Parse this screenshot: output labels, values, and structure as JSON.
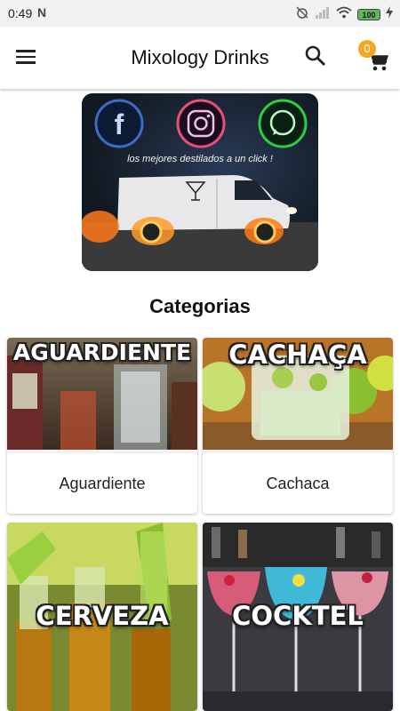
{
  "status_bar": {
    "time": "0:49",
    "notification_letter": "N",
    "battery_level": "100"
  },
  "app_bar": {
    "title": "Mixology Drinks",
    "cart_count": "0",
    "icons": [
      "menu-icon",
      "search-icon",
      "cart-icon"
    ]
  },
  "banner": {
    "tagline": "los mejores destilados a un click !",
    "social_icons": [
      "facebook-icon",
      "instagram-icon",
      "whatsapp-icon"
    ]
  },
  "section": {
    "title": "Categorias"
  },
  "categories": [
    {
      "overlay": "AGUARDIENTE",
      "label": "Aguardiente"
    },
    {
      "overlay": "CACHAÇA",
      "label": "Cachaca"
    },
    {
      "overlay": "CERVEZA",
      "label": ""
    },
    {
      "overlay": "COCKTEL",
      "label": ""
    }
  ],
  "colors": {
    "badge": "#f5a623",
    "facebook_ring": "#3b6dc8",
    "whatsapp_ring": "#2ecc40"
  }
}
